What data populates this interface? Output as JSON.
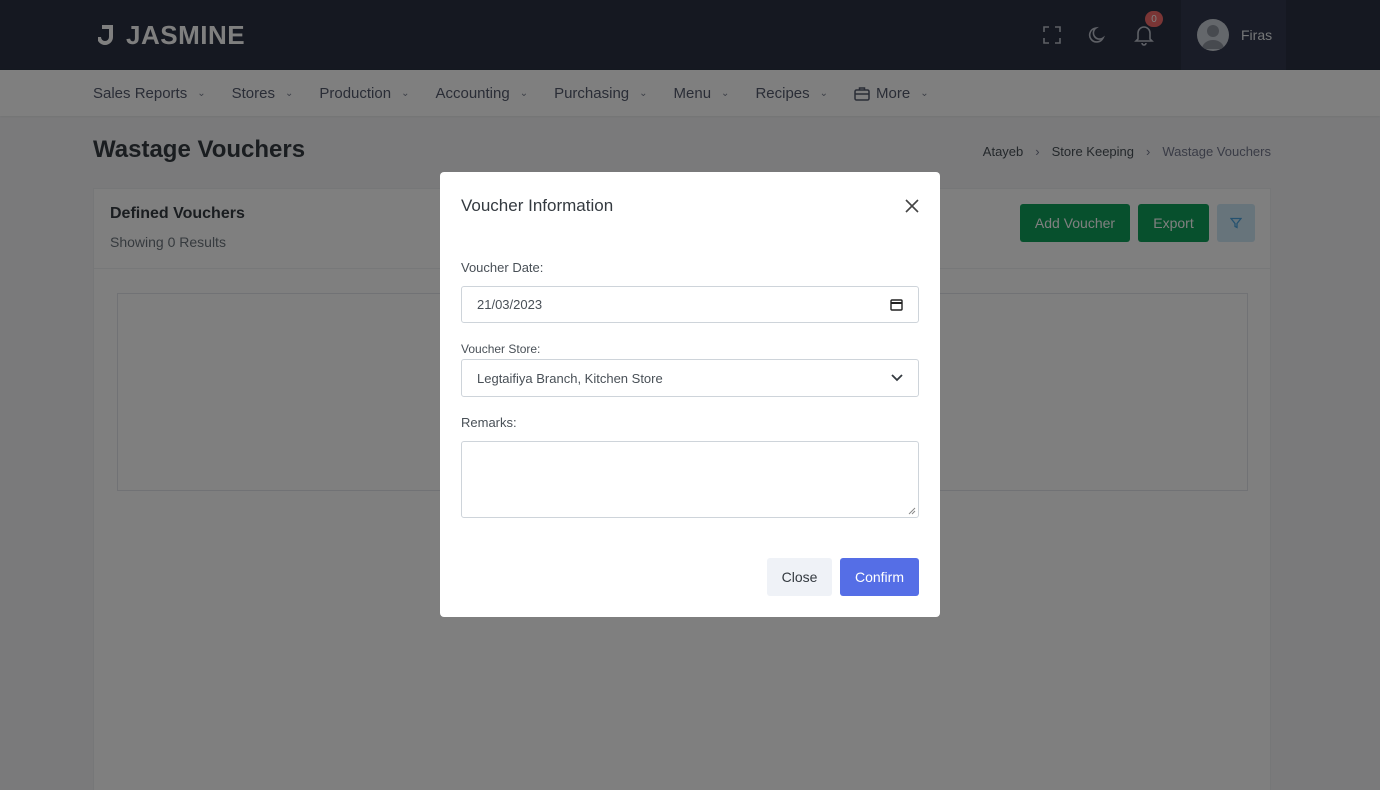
{
  "header": {
    "brand": "JASMINE",
    "notifications_count": "0",
    "user_name": "Firas",
    "icons": [
      "fullscreen-icon",
      "moon-icon",
      "bell-icon"
    ]
  },
  "nav": {
    "items": [
      {
        "label": "Sales Reports"
      },
      {
        "label": "Stores"
      },
      {
        "label": "Production"
      },
      {
        "label": "Accounting"
      },
      {
        "label": "Purchasing"
      },
      {
        "label": "Menu"
      },
      {
        "label": "Recipes"
      },
      {
        "label": "More",
        "icon": "briefcase-icon"
      }
    ]
  },
  "page": {
    "title": "Wastage Vouchers",
    "breadcrumb": [
      "Atayeb",
      "Store Keeping",
      "Wastage Vouchers"
    ]
  },
  "card": {
    "title": "Defined Vouchers",
    "subtitle": "Showing 0 Results",
    "add_label": "Add Voucher",
    "export_label": "Export",
    "filter_icon": "filter-icon"
  },
  "modal": {
    "title": "Voucher Information",
    "date_label": "Voucher Date:",
    "date_value": "21/03/2023",
    "store_label": "Voucher Store:",
    "store_value": "Legtaifiya Branch, Kitchen Store",
    "remarks_label": "Remarks:",
    "remarks_value": "",
    "close_label": "Close",
    "confirm_label": "Confirm"
  },
  "colors": {
    "topbar": "#2a3042",
    "success": "#0fa15a",
    "primary": "#556ee6",
    "badge": "#f46a6a"
  }
}
